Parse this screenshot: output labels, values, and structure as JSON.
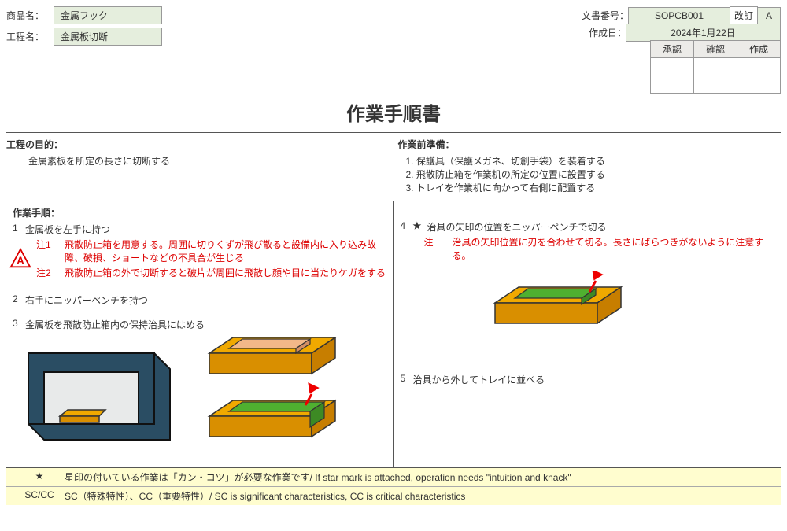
{
  "labels": {
    "product": "商品名：",
    "process": "工程名：",
    "docnum": "文書番号：",
    "revision": "改訂",
    "created": "作成日：",
    "approve": "承認",
    "confirm": "確認",
    "make": "作成"
  },
  "values": {
    "product": "金属フック",
    "process": "金属板切断",
    "docnum": "SOPCB001",
    "revision": "A",
    "created": "2024年1月22日"
  },
  "title": "作業手順書",
  "purpose": {
    "heading": "工程の目的：",
    "text": "金属素板を所定の長さに切断する"
  },
  "preparation": {
    "heading": "作業前準備：",
    "items": [
      "1. 保護具（保護メガネ、切創手袋）を装着する",
      "2. 飛散防止箱を作業机の所定の位置に設置する",
      "3. トレイを作業机に向かって右側に配置する"
    ]
  },
  "steps_heading": "作業手順：",
  "left_steps": {
    "s1": {
      "num": "1",
      "text": "金属板を左手に持つ"
    },
    "s1_note1": {
      "tag": "注1",
      "text": "飛散防止箱を用意する。周囲に切りくずが飛び散ると設備内に入り込み故障、破損、ショートなどの不具合が生じる"
    },
    "s1_note2": {
      "tag": "注2",
      "text": "飛散防止箱の外で切断すると破片が周囲に飛散し顔や目に当たりケガをする"
    },
    "warn_letter": "A",
    "s2": {
      "num": "2",
      "text": "右手にニッパーペンチを持つ"
    },
    "s3": {
      "num": "3",
      "text": "金属板を飛散防止箱内の保持治具にはめる"
    }
  },
  "right_steps": {
    "s4": {
      "num": "4",
      "star": "★",
      "text": "治具の矢印の位置をニッパーペンチで切る"
    },
    "s4_note": {
      "tag": "注",
      "text": "治具の矢印位置に刃を合わせて切る。長さにばらつきがないように注意する。"
    },
    "s5": {
      "num": "5",
      "text": "治具から外してトレイに並べる"
    }
  },
  "legend": {
    "r1": {
      "key": "★",
      "text": "星印の付いている作業は「カン・コツ」が必要な作業です/ If star mark is attached, operation needs \"intuition and knack\""
    },
    "r2": {
      "key": "SC/CC",
      "text": "SC（特殊特性）、CC（重要特性）/ SC is significant characteristics, CC is critical characteristics"
    }
  }
}
